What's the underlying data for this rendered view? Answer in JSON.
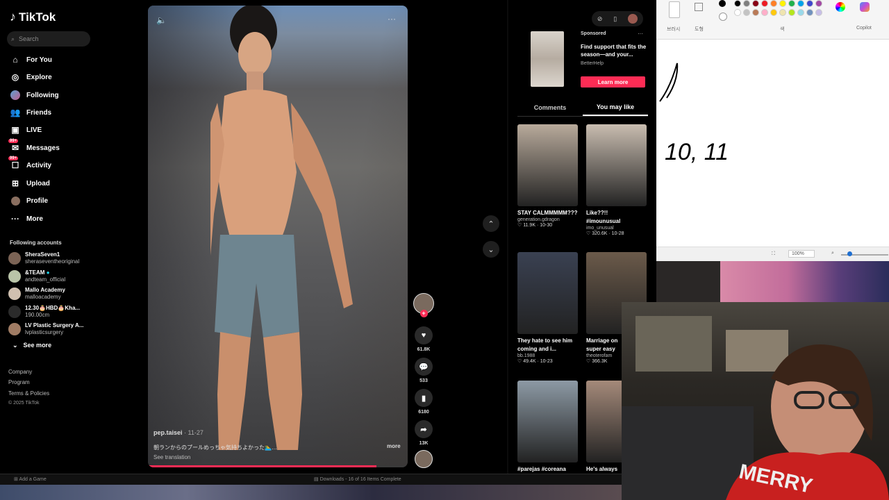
{
  "app": {
    "name": "TikTok"
  },
  "search": {
    "placeholder": "Search"
  },
  "nav": [
    {
      "label": "For You",
      "icon": "home-icon",
      "badge": ""
    },
    {
      "label": "Explore",
      "icon": "compass-icon",
      "badge": ""
    },
    {
      "label": "Following",
      "icon": "following-icon",
      "badge": ""
    },
    {
      "label": "Friends",
      "icon": "friends-icon",
      "badge": ""
    },
    {
      "label": "LIVE",
      "icon": "live-icon",
      "badge": ""
    },
    {
      "label": "Messages",
      "icon": "messages-icon",
      "badge": "99+"
    },
    {
      "label": "Activity",
      "icon": "activity-icon",
      "badge": "99+"
    },
    {
      "label": "Upload",
      "icon": "upload-icon",
      "badge": ""
    },
    {
      "label": "Profile",
      "icon": "profile-icon",
      "badge": ""
    },
    {
      "label": "More",
      "icon": "more-icon",
      "badge": ""
    }
  ],
  "following": {
    "title": "Following accounts",
    "accounts": [
      {
        "name": "SheraSeven1",
        "handle": "sheraseventheoriginal"
      },
      {
        "name": "&TEAM",
        "handle": "andteam_official"
      },
      {
        "name": "Mallo Academy",
        "handle": "malloacademy"
      },
      {
        "name": "12.30🎂HBD🎂Kha...",
        "handle": "190.00cm"
      },
      {
        "name": "LV Plastic Surgery A...",
        "handle": "lvplasticsurgery"
      }
    ],
    "see_more": "See more"
  },
  "footer": {
    "links": [
      "Company",
      "Program",
      "Terms & Policies"
    ],
    "copyright": "© 2025 TikTok"
  },
  "video": {
    "user": "pep.taisei",
    "date": "· 11-27",
    "caption": "朝ランからのプールめっちゃ気持ちよかった🏊‍♂️…",
    "translate": "See translation",
    "more": "more",
    "progress": 0.88
  },
  "actions": {
    "likes": "61.8K",
    "comments": "533",
    "saves": "6180",
    "shares": "13K"
  },
  "ad": {
    "sponsored": "Sponsored",
    "title": "Find support that fits the season—and your...",
    "brand": "BetterHelp",
    "cta": "Learn more"
  },
  "tabs": [
    "Comments",
    "You may like"
  ],
  "cards": [
    {
      "title": "STAY CALMMMMM???...",
      "author": "generation.gdragon",
      "stats": "♡ 11.9K · 10-30",
      "color": "#b8aa9b"
    },
    {
      "title": "Like??!! #imounusual",
      "author": "imo_unusual",
      "stats": "♡ 320.6K · 10-28",
      "color": "#c9bdb0"
    },
    {
      "title": "They hate to see him coming and i...",
      "author": "bb.1988",
      "stats": "♡ 49.4K · 10-23",
      "color": "#3a4152"
    },
    {
      "title": "Marriage on super easy",
      "author": "theoterofam",
      "stats": "♡ 366.3K",
      "color": "#6b5a4a"
    },
    {
      "title": "#parejas #coreana",
      "author": "",
      "stats": "",
      "color": "#8d9aa5"
    },
    {
      "title": "He's always",
      "author": "",
      "stats": "",
      "color": "#a58a7a"
    }
  ],
  "paint": {
    "labels": [
      "브러시",
      "도형",
      "색",
      "Copilot"
    ],
    "zoom": "100%",
    "drawn_text": "10, 11"
  },
  "taskbar": {
    "left": "Add a Game",
    "center": "Downloads - 16 of 16 Items Complete"
  },
  "colors": {
    "accent": "#fe2c55",
    "bg": "#000000"
  }
}
